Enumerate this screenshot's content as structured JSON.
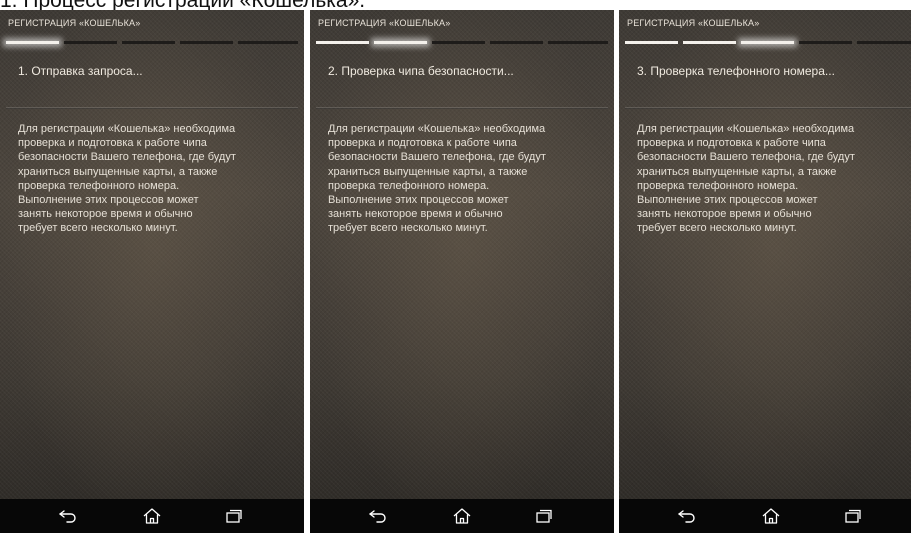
{
  "caption": "1. Процесс регистрации «Кошелька».",
  "screens": [
    {
      "app_title": "РЕГИСТРАЦИЯ «КОШЕЛЬКА»",
      "step_title": "1. Отправка запроса...",
      "progress_step": 1,
      "body": "Для регистрации «Кошелька» необходима\nпроверка и подготовка к работе чипа\nбезопасности Вашего телефона, где будут\nхраниться выпущенные карты, а также\nпроверка телефонного номера.\nВыполнение этих процессов может\nзанять некоторое время и обычно\nтребует всего несколько минут."
    },
    {
      "app_title": "РЕГИСТРАЦИЯ «КОШЕЛЬКА»",
      "step_title": "2. Проверка чипа безопасности...",
      "progress_step": 2,
      "body": "Для регистрации «Кошелька» необходима\nпроверка и подготовка к работе чипа\nбезопасности Вашего телефона, где будут\nхраниться выпущенные карты, а также\nпроверка телефонного номера.\nВыполнение этих процессов может\nзанять некоторое время и обычно\nтребует всего несколько минут."
    },
    {
      "app_title": "РЕГИСТРАЦИЯ «КОШЕЛЬКА»",
      "step_title": "3. Проверка телефонного номера...",
      "progress_step": 3,
      "body": "Для регистрации «Кошелька» необходима\nпроверка и подготовка к работе чипа\nбезопасности Вашего телефона, где будут\nхраниться выпущенные карты, а также\nпроверка телефонного номера.\nВыполнение этих процессов может\nзанять некоторое время и обычно\nтребует всего несколько минут."
    }
  ],
  "progress_total_steps": 5,
  "navbar": {
    "icons": [
      "back-icon",
      "home-icon",
      "recent-apps-icon"
    ]
  },
  "colors": {
    "screen_bg": "#45403a",
    "navbar_bg": "#070707",
    "text": "#e6e0d6",
    "progress_done": "#f4f1ec",
    "progress_pending": "#1e1c1a"
  }
}
